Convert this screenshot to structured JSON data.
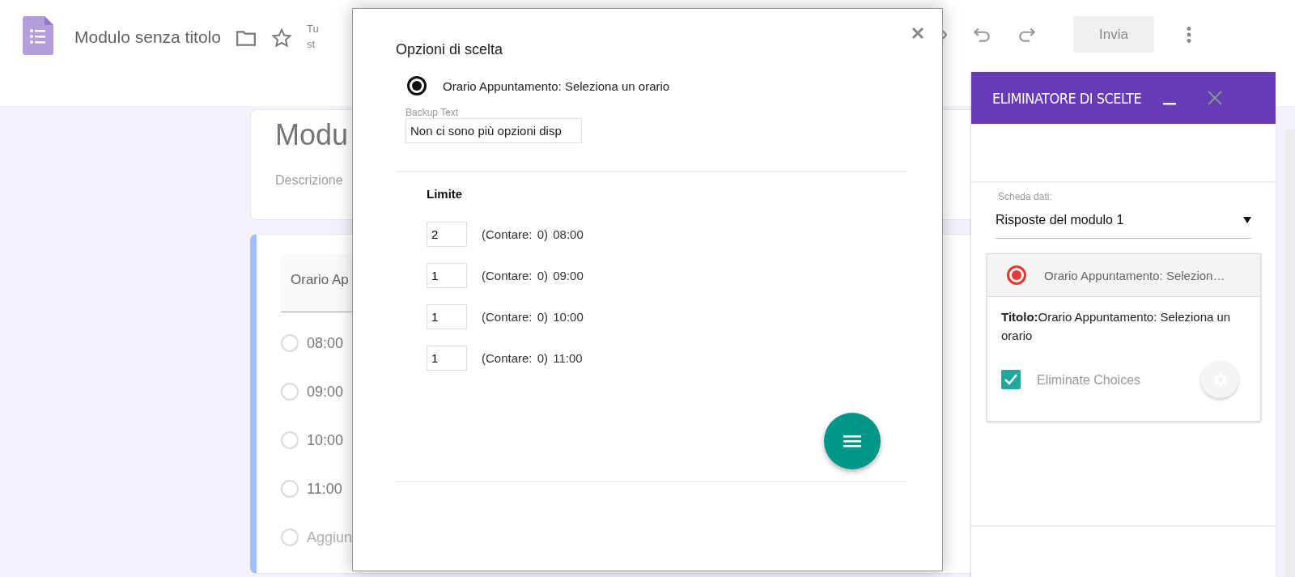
{
  "header": {
    "title": "Modulo senza titolo",
    "note_lines": [
      "Tu",
      "st"
    ],
    "send_button": {
      "label": "Invia",
      "disabled": true
    }
  },
  "form": {
    "title": "Modu",
    "description": "Descrizione",
    "question": {
      "title": "Orario Ap",
      "options": [
        {
          "label": "08:00",
          "kind": "option",
          "selected": false
        },
        {
          "label": "09:00",
          "kind": "option",
          "selected": false
        },
        {
          "label": "10:00",
          "kind": "option",
          "selected": false
        },
        {
          "label": "11:00",
          "kind": "option",
          "selected": false
        },
        {
          "label": "Aggiun",
          "kind": "add",
          "selected": false
        }
      ]
    }
  },
  "dialog": {
    "title": "Opzioni di scelta",
    "question": {
      "label": "Orario Appuntamento: Seleziona un orario",
      "selected": true
    },
    "backup_text": {
      "label": "Backup Text",
      "value": "Non ci sono più opzioni disp"
    },
    "limit_heading": "Limite",
    "limits": [
      {
        "value": "2",
        "count": "(Contare: 0)",
        "option": "08:00"
      },
      {
        "value": "1",
        "count": "(Contare: 0)",
        "option": "09:00"
      },
      {
        "value": "1",
        "count": "(Contare: 0)",
        "option": "10:00"
      },
      {
        "value": "1",
        "count": "(Contare: 0)",
        "option": "11:00"
      }
    ]
  },
  "sidebar": {
    "title": "ELIMINATORE DI SCELTE",
    "sheet": {
      "label": "Scheda dati:",
      "value": "Risposte del modulo 1"
    },
    "question_card": {
      "header": "Orario Appuntamento: Selezion…",
      "selected": true,
      "title": "**Titolo:**Orario Appuntamento: Seleziona un orario",
      "eliminate": {
        "label": "Eliminate Choices",
        "checked": true
      }
    }
  }
}
